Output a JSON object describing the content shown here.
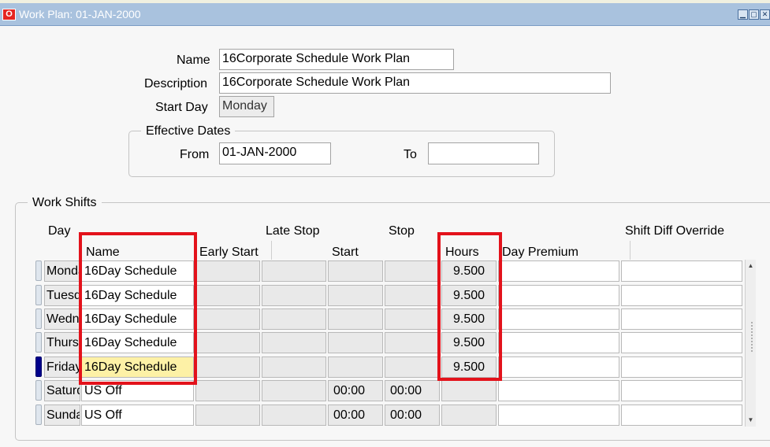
{
  "window": {
    "title": "Work Plan: 01-JAN-2000",
    "app_icon": "oracle-icon",
    "controls": [
      "minimize-icon",
      "maximize-icon",
      "close-icon"
    ]
  },
  "header": {
    "name_label": "Name",
    "name_value": "16Corporate Schedule Work Plan",
    "description_label": "Description",
    "description_value": "16Corporate Schedule Work Plan",
    "start_day_label": "Start Day",
    "start_day_value": "Monday"
  },
  "effective_dates": {
    "title": "Effective Dates",
    "from_label": "From",
    "from_value": "01-JAN-2000",
    "to_label": "To",
    "to_value": ""
  },
  "work_shifts": {
    "title": "Work Shifts",
    "headers": {
      "day": "Day",
      "name": "Name",
      "early_start": "Early Start",
      "late_stop": "Late Stop",
      "start": "Start",
      "stop": "Stop",
      "hours": "Hours",
      "day_premium": "Day Premium",
      "shift_diff_override": "Shift Diff Override"
    },
    "rows": [
      {
        "day": "Monday",
        "name": "16Day Schedule",
        "early_start": "",
        "late_stop": "",
        "start": "",
        "stop": "",
        "hours": "9.500",
        "day_premium": "",
        "shift_diff": ""
      },
      {
        "day": "Tuesday",
        "name": "16Day Schedule",
        "early_start": "",
        "late_stop": "",
        "start": "",
        "stop": "",
        "hours": "9.500",
        "day_premium": "",
        "shift_diff": ""
      },
      {
        "day": "Wednesday",
        "name": "16Day Schedule",
        "early_start": "",
        "late_stop": "",
        "start": "",
        "stop": "",
        "hours": "9.500",
        "day_premium": "",
        "shift_diff": ""
      },
      {
        "day": "Thursday",
        "name": "16Day Schedule",
        "early_start": "",
        "late_stop": "",
        "start": "",
        "stop": "",
        "hours": "9.500",
        "day_premium": "",
        "shift_diff": ""
      },
      {
        "day": "Friday",
        "name": "16Day Schedule",
        "early_start": "",
        "late_stop": "",
        "start": "",
        "stop": "",
        "hours": "9.500",
        "day_premium": "",
        "shift_diff": ""
      },
      {
        "day": "Saturday",
        "name": "US Off",
        "early_start": "",
        "late_stop": "",
        "start": "00:00",
        "stop": "00:00",
        "hours": "",
        "day_premium": "",
        "shift_diff": ""
      },
      {
        "day": "Sunday",
        "name": "US Off",
        "early_start": "",
        "late_stop": "",
        "start": "00:00",
        "stop": "00:00",
        "hours": "",
        "day_premium": "",
        "shift_diff": ""
      }
    ],
    "current_row_index": 4
  },
  "colors": {
    "titlebar": "#a9c2de",
    "highlight_box": "#e3121b",
    "current_field": "#fdf1a6",
    "row_indicator_active": "#00008b"
  }
}
